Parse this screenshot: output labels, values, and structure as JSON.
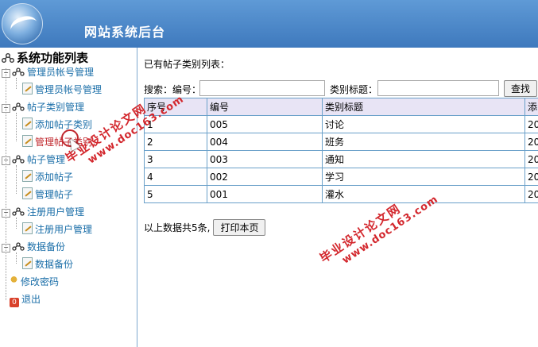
{
  "header": {
    "title": "网站系统后台",
    "logo": "dolphin-logo"
  },
  "sidebar": {
    "title": "系统功能列表",
    "groups": [
      {
        "label": "管理员帐号管理",
        "items": [
          {
            "label": "管理员帐号管理"
          }
        ]
      },
      {
        "label": "帖子类别管理",
        "items": [
          {
            "label": "添加帖子类别"
          },
          {
            "label": "管理帖子类别",
            "active": true
          }
        ]
      },
      {
        "label": "帖子管理",
        "items": [
          {
            "label": "添加帖子"
          },
          {
            "label": "管理帖子"
          }
        ]
      },
      {
        "label": "注册用户管理",
        "items": [
          {
            "label": "注册用户管理"
          }
        ]
      },
      {
        "label": "数据备份",
        "items": [
          {
            "label": "数据备份"
          }
        ]
      }
    ],
    "extra": [
      {
        "label": "修改密码",
        "icon": "key-icon"
      },
      {
        "label": "退出",
        "icon": "exit-icon"
      }
    ]
  },
  "main": {
    "list_title": "已有帖子类别列表：",
    "search": {
      "code_label": "搜索：编号：",
      "title_label": "类别标题：",
      "code_value": "",
      "title_value": "",
      "button": "查找"
    },
    "table": {
      "headers": [
        "序号",
        "编号",
        "类别标题",
        "添"
      ],
      "rows": [
        [
          "1",
          "005",
          "讨论",
          "20"
        ],
        [
          "2",
          "004",
          "班务",
          "20"
        ],
        [
          "3",
          "003",
          "通知",
          "20"
        ],
        [
          "4",
          "002",
          "学习",
          "20"
        ],
        [
          "5",
          "001",
          "灌水",
          "20"
        ]
      ]
    },
    "summary": "以上数据共5条,",
    "print_button": "打印本页"
  },
  "watermark": {
    "text": "毕业设计论文网",
    "url": "www.doc163.com"
  },
  "colors": {
    "header": "#4a86c8",
    "link": "#1a6ea8",
    "active": "#c0272d",
    "table_header": "#e8e4f5",
    "table_border": "#6aa0c9",
    "watermark": "#d3272d"
  }
}
